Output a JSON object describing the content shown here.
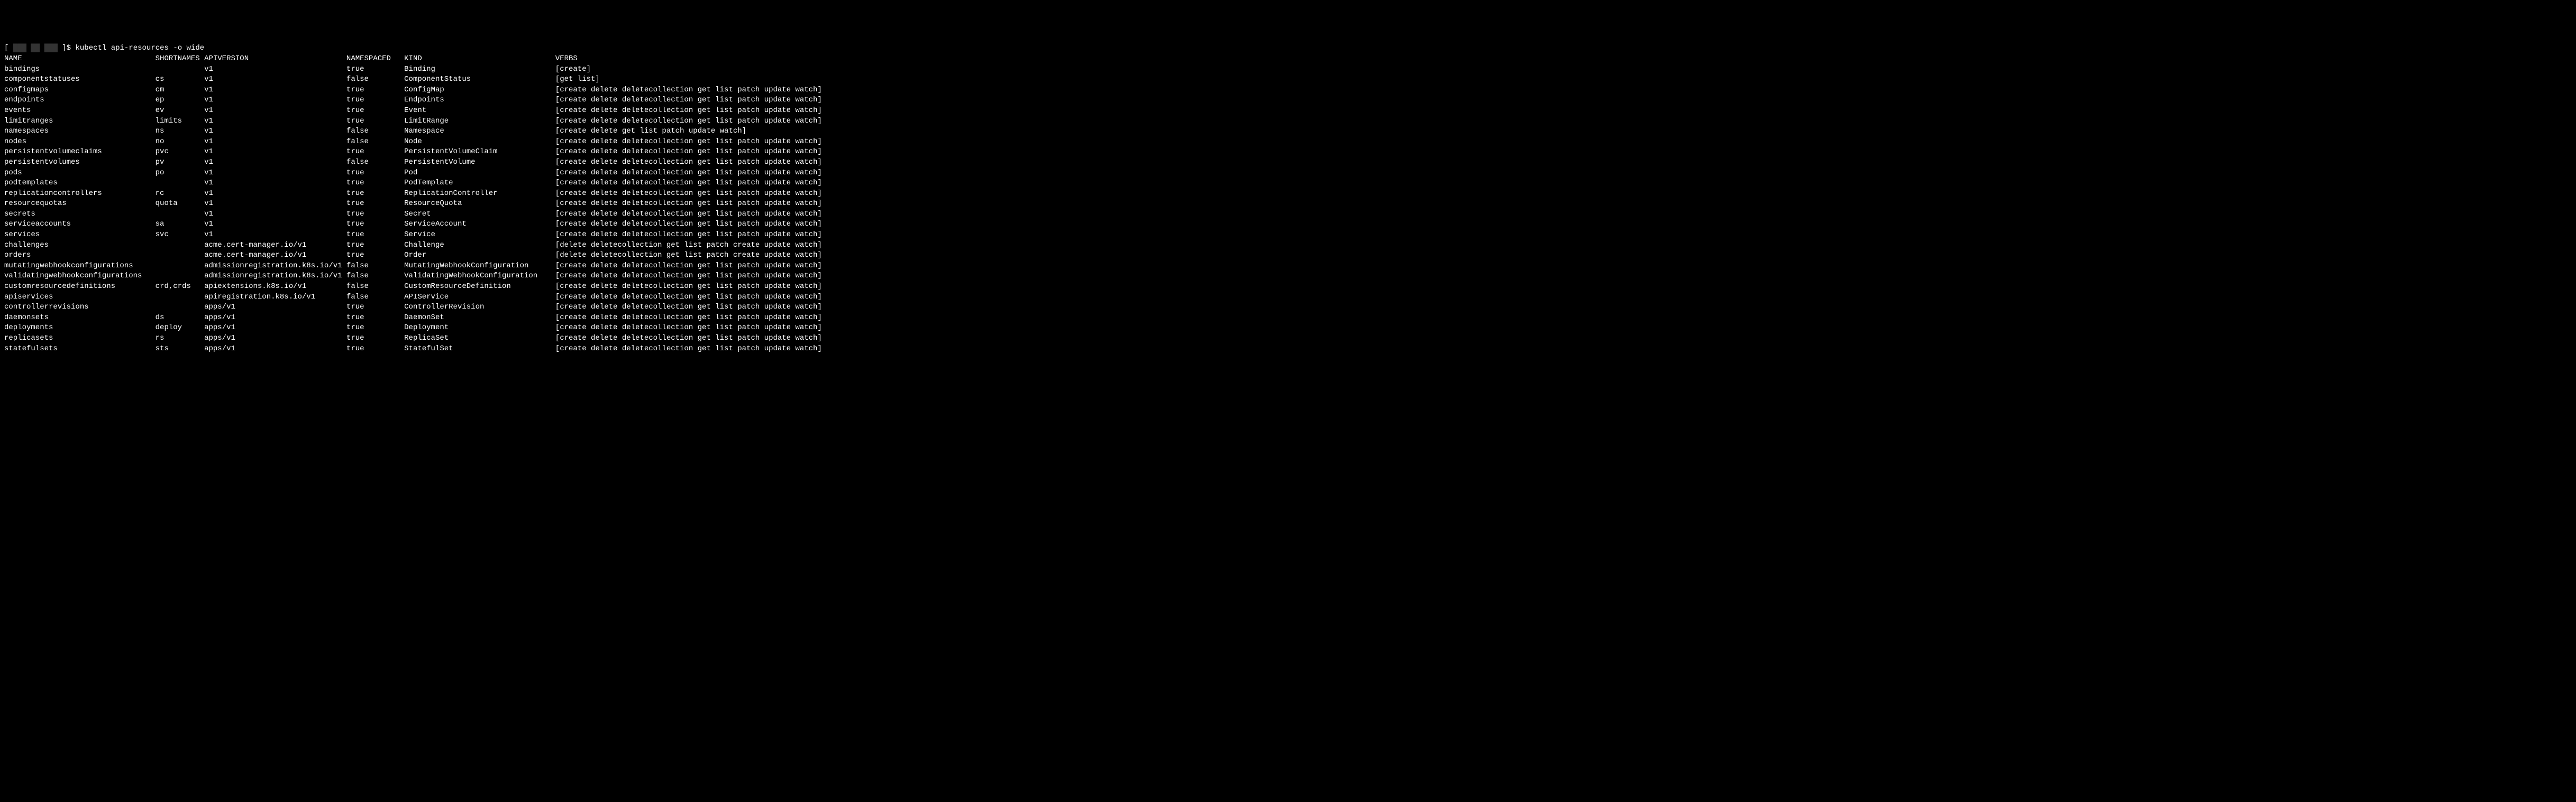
{
  "prompt": {
    "prefix": "[ ",
    "redacted_segments": [
      "███",
      "██",
      "███"
    ],
    "suffix": " ]$ ",
    "command": "kubectl api-resources -o wide"
  },
  "columns": {
    "name": "NAME",
    "shortnames": "SHORTNAMES",
    "apiversion": "APIVERSION",
    "namespaced": "NAMESPACED",
    "kind": "KIND",
    "verbs": "VERBS"
  },
  "col_widths": {
    "name": 34,
    "shortnames": 11,
    "apiversion": 32,
    "namespaced": 13,
    "kind": 34
  },
  "rows": [
    {
      "name": "bindings",
      "shortnames": "",
      "apiversion": "v1",
      "namespaced": "true",
      "kind": "Binding",
      "verbs": "[create]"
    },
    {
      "name": "componentstatuses",
      "shortnames": "cs",
      "apiversion": "v1",
      "namespaced": "false",
      "kind": "ComponentStatus",
      "verbs": "[get list]"
    },
    {
      "name": "configmaps",
      "shortnames": "cm",
      "apiversion": "v1",
      "namespaced": "true",
      "kind": "ConfigMap",
      "verbs": "[create delete deletecollection get list patch update watch]"
    },
    {
      "name": "endpoints",
      "shortnames": "ep",
      "apiversion": "v1",
      "namespaced": "true",
      "kind": "Endpoints",
      "verbs": "[create delete deletecollection get list patch update watch]"
    },
    {
      "name": "events",
      "shortnames": "ev",
      "apiversion": "v1",
      "namespaced": "true",
      "kind": "Event",
      "verbs": "[create delete deletecollection get list patch update watch]"
    },
    {
      "name": "limitranges",
      "shortnames": "limits",
      "apiversion": "v1",
      "namespaced": "true",
      "kind": "LimitRange",
      "verbs": "[create delete deletecollection get list patch update watch]"
    },
    {
      "name": "namespaces",
      "shortnames": "ns",
      "apiversion": "v1",
      "namespaced": "false",
      "kind": "Namespace",
      "verbs": "[create delete get list patch update watch]"
    },
    {
      "name": "nodes",
      "shortnames": "no",
      "apiversion": "v1",
      "namespaced": "false",
      "kind": "Node",
      "verbs": "[create delete deletecollection get list patch update watch]"
    },
    {
      "name": "persistentvolumeclaims",
      "shortnames": "pvc",
      "apiversion": "v1",
      "namespaced": "true",
      "kind": "PersistentVolumeClaim",
      "verbs": "[create delete deletecollection get list patch update watch]"
    },
    {
      "name": "persistentvolumes",
      "shortnames": "pv",
      "apiversion": "v1",
      "namespaced": "false",
      "kind": "PersistentVolume",
      "verbs": "[create delete deletecollection get list patch update watch]"
    },
    {
      "name": "pods",
      "shortnames": "po",
      "apiversion": "v1",
      "namespaced": "true",
      "kind": "Pod",
      "verbs": "[create delete deletecollection get list patch update watch]"
    },
    {
      "name": "podtemplates",
      "shortnames": "",
      "apiversion": "v1",
      "namespaced": "true",
      "kind": "PodTemplate",
      "verbs": "[create delete deletecollection get list patch update watch]"
    },
    {
      "name": "replicationcontrollers",
      "shortnames": "rc",
      "apiversion": "v1",
      "namespaced": "true",
      "kind": "ReplicationController",
      "verbs": "[create delete deletecollection get list patch update watch]"
    },
    {
      "name": "resourcequotas",
      "shortnames": "quota",
      "apiversion": "v1",
      "namespaced": "true",
      "kind": "ResourceQuota",
      "verbs": "[create delete deletecollection get list patch update watch]"
    },
    {
      "name": "secrets",
      "shortnames": "",
      "apiversion": "v1",
      "namespaced": "true",
      "kind": "Secret",
      "verbs": "[create delete deletecollection get list patch update watch]"
    },
    {
      "name": "serviceaccounts",
      "shortnames": "sa",
      "apiversion": "v1",
      "namespaced": "true",
      "kind": "ServiceAccount",
      "verbs": "[create delete deletecollection get list patch update watch]"
    },
    {
      "name": "services",
      "shortnames": "svc",
      "apiversion": "v1",
      "namespaced": "true",
      "kind": "Service",
      "verbs": "[create delete deletecollection get list patch update watch]"
    },
    {
      "name": "challenges",
      "shortnames": "",
      "apiversion": "acme.cert-manager.io/v1",
      "namespaced": "true",
      "kind": "Challenge",
      "verbs": "[delete deletecollection get list patch create update watch]"
    },
    {
      "name": "orders",
      "shortnames": "",
      "apiversion": "acme.cert-manager.io/v1",
      "namespaced": "true",
      "kind": "Order",
      "verbs": "[delete deletecollection get list patch create update watch]"
    },
    {
      "name": "mutatingwebhookconfigurations",
      "shortnames": "",
      "apiversion": "admissionregistration.k8s.io/v1",
      "namespaced": "false",
      "kind": "MutatingWebhookConfiguration",
      "verbs": "[create delete deletecollection get list patch update watch]"
    },
    {
      "name": "validatingwebhookconfigurations",
      "shortnames": "",
      "apiversion": "admissionregistration.k8s.io/v1",
      "namespaced": "false",
      "kind": "ValidatingWebhookConfiguration",
      "verbs": "[create delete deletecollection get list patch update watch]"
    },
    {
      "name": "customresourcedefinitions",
      "shortnames": "crd,crds",
      "apiversion": "apiextensions.k8s.io/v1",
      "namespaced": "false",
      "kind": "CustomResourceDefinition",
      "verbs": "[create delete deletecollection get list patch update watch]"
    },
    {
      "name": "apiservices",
      "shortnames": "",
      "apiversion": "apiregistration.k8s.io/v1",
      "namespaced": "false",
      "kind": "APIService",
      "verbs": "[create delete deletecollection get list patch update watch]"
    },
    {
      "name": "controllerrevisions",
      "shortnames": "",
      "apiversion": "apps/v1",
      "namespaced": "true",
      "kind": "ControllerRevision",
      "verbs": "[create delete deletecollection get list patch update watch]"
    },
    {
      "name": "daemonsets",
      "shortnames": "ds",
      "apiversion": "apps/v1",
      "namespaced": "true",
      "kind": "DaemonSet",
      "verbs": "[create delete deletecollection get list patch update watch]"
    },
    {
      "name": "deployments",
      "shortnames": "deploy",
      "apiversion": "apps/v1",
      "namespaced": "true",
      "kind": "Deployment",
      "verbs": "[create delete deletecollection get list patch update watch]"
    },
    {
      "name": "replicasets",
      "shortnames": "rs",
      "apiversion": "apps/v1",
      "namespaced": "true",
      "kind": "ReplicaSet",
      "verbs": "[create delete deletecollection get list patch update watch]"
    },
    {
      "name": "statefulsets",
      "shortnames": "sts",
      "apiversion": "apps/v1",
      "namespaced": "true",
      "kind": "StatefulSet",
      "verbs": "[create delete deletecollection get list patch update watch]"
    }
  ]
}
